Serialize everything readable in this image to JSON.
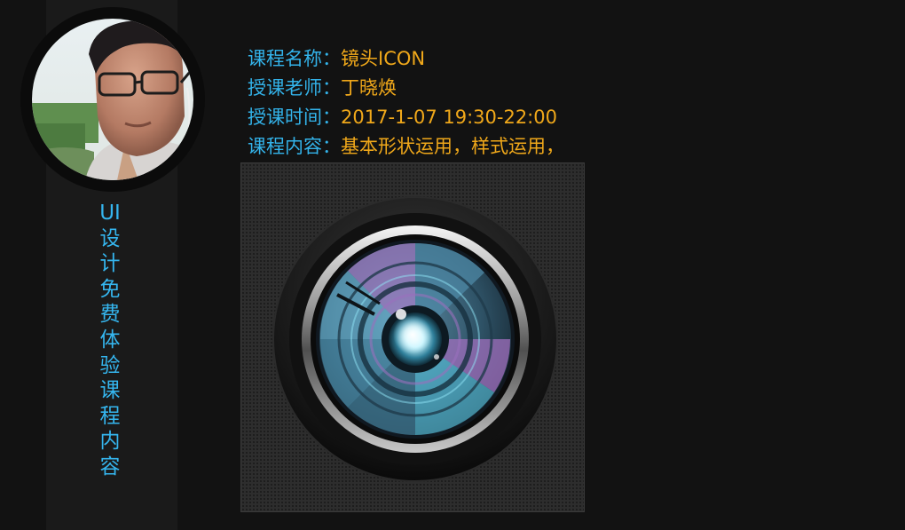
{
  "sidebar": {
    "vertical_title": "UI设计免费体验课程内容"
  },
  "course_info": {
    "rows": [
      {
        "label": "课程名称：",
        "value": "镜头ICON"
      },
      {
        "label": "授课老师：",
        "value": "丁晓焕"
      },
      {
        "label": "授课时间：",
        "value": "2017-1-07  19:30-22:00"
      },
      {
        "label": "课程内容：",
        "value": "基本形状运用，样式运用，"
      }
    ]
  },
  "colors": {
    "background": "#121212",
    "side_panel": "#1a1a1a",
    "label": "#33b3ea",
    "value": "#f0a81a",
    "lens_cyan": "#6fd3f0",
    "lens_purple": "#a774c4"
  },
  "icons": {
    "avatar": "instructor-portrait",
    "lens": "camera-lens-icon"
  }
}
